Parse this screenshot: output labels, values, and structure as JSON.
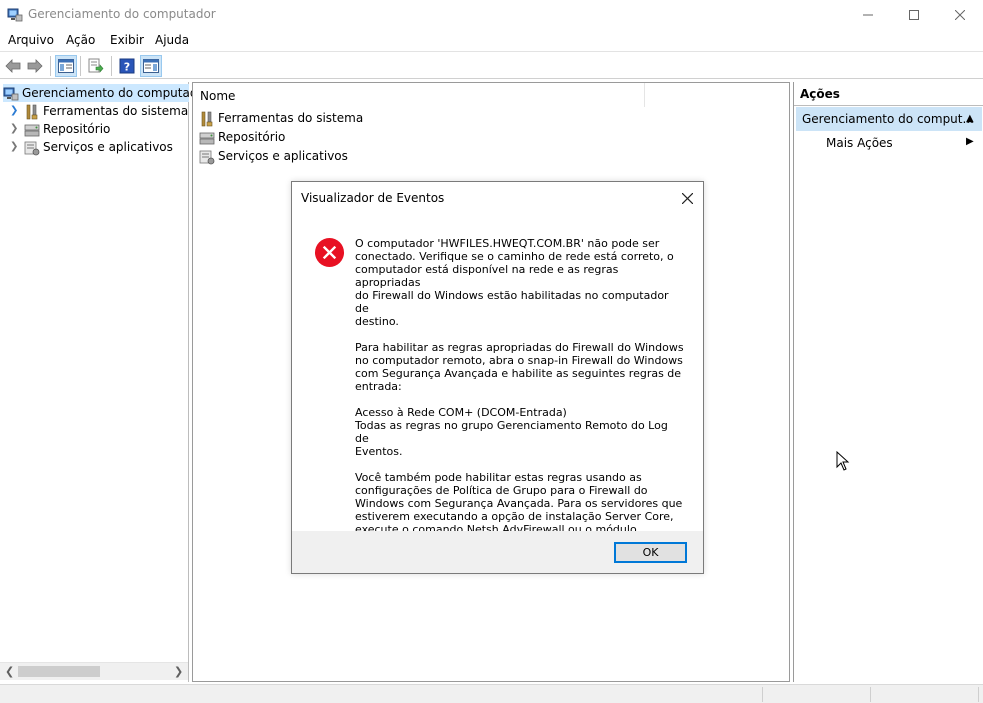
{
  "window": {
    "title": "Gerenciamento do computador"
  },
  "menu": {
    "items": [
      "Arquivo",
      "Ação",
      "Exibir",
      "Ajuda"
    ]
  },
  "toolbar": {
    "icons": [
      "back-arrow-icon",
      "forward-arrow-icon",
      "show-hide-console-tree-icon",
      "export-list-icon",
      "help-icon",
      "show-hide-action-pane-icon"
    ]
  },
  "tree": {
    "root": "Gerenciamento do computador",
    "children": [
      "Ferramentas do sistema",
      "Repositório",
      "Serviços e aplicativos"
    ]
  },
  "center": {
    "column_header": "Nome",
    "rows": [
      "Ferramentas do sistema",
      "Repositório",
      "Serviços e aplicativos"
    ]
  },
  "actions": {
    "header": "Ações",
    "section": "Gerenciamento do comput...",
    "more_actions": "Mais Ações"
  },
  "dialog": {
    "title": "Visualizador de Eventos",
    "paragraphs": [
      "O computador 'HWFILES.HWEQT.COM.BR'  não pode ser\nconectado. Verifique se o caminho de rede está correto, o\ncomputador está disponível na rede e as regras apropriadas\ndo Firewall do Windows estão habilitadas no computador de\ndestino.",
      "Para habilitar as regras apropriadas do Firewall do Windows\nno computador remoto, abra o snap-in Firewall do Windows\ncom Segurança Avançada e habilite as seguintes regras de\nentrada:",
      " Acesso à Rede COM+ (DCOM-Entrada)\nTodas as regras no grupo Gerenciamento Remoto do Log de\nEventos.",
      "Você também pode habilitar estas regras usando as\nconfigurações de Política de Grupo para o Firewall do\nWindows com Segurança Avançada. Para os servidores que\nestiverem executando a opção de instalação Server Core,\nexecute o comando Netsh AdvFirewall ou o módulo\nPowerShell NetSecurity do Windows."
    ],
    "ok_label": "OK"
  },
  "colors": {
    "selection": "#cce8ff",
    "action_section": "#cce4f7",
    "error_red": "#e81123",
    "ok_border": "#0078d7"
  }
}
